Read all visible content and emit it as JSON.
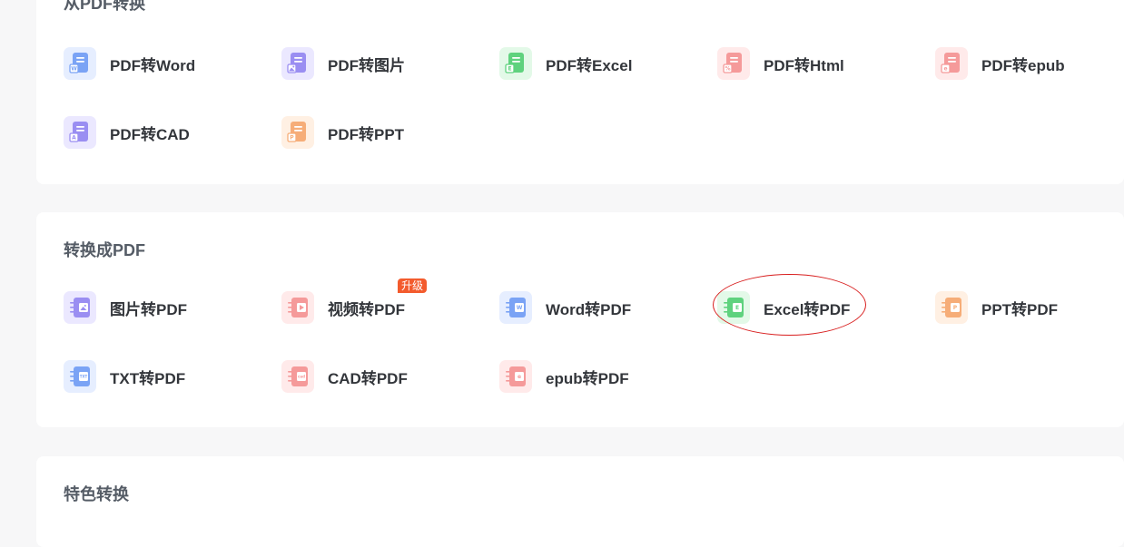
{
  "sections": [
    {
      "title": "从PDF转换",
      "tools": [
        {
          "label": "PDF转Word",
          "icon": "pdf-to-word-icon",
          "bg": "#e6eeff",
          "fg": "#7aa3f5",
          "mark": "W"
        },
        {
          "label": "PDF转图片",
          "icon": "pdf-to-image-icon",
          "bg": "#ebe8ff",
          "fg": "#9a8ef2",
          "mark": "img"
        },
        {
          "label": "PDF转Excel",
          "icon": "pdf-to-excel-icon",
          "bg": "#e3f9e8",
          "fg": "#5fd27e",
          "mark": "E"
        },
        {
          "label": "PDF转Html",
          "icon": "pdf-to-html-icon",
          "bg": "#ffeaea",
          "fg": "#f59a9a",
          "mark": "%"
        },
        {
          "label": "PDF转epub",
          "icon": "pdf-to-epub-icon",
          "bg": "#ffeaea",
          "fg": "#f59a9a",
          "mark": "e"
        },
        {
          "label": "PDF转CAD",
          "icon": "pdf-to-cad-icon",
          "bg": "#ebe8ff",
          "fg": "#9a8ef2",
          "mark": "A"
        },
        {
          "label": "PDF转PPT",
          "icon": "pdf-to-ppt-icon",
          "bg": "#fff0e3",
          "fg": "#f6ad78",
          "mark": "P"
        }
      ]
    },
    {
      "title": "转换成PDF",
      "tools": [
        {
          "label": "图片转PDF",
          "icon": "image-to-pdf-icon",
          "bg": "#ebe8ff",
          "fg": "#9a8ef2",
          "mark": "img"
        },
        {
          "label": "视频转PDF",
          "icon": "video-to-pdf-icon",
          "bg": "#ffeaea",
          "fg": "#f59a9a",
          "mark": "play",
          "badge": "升级"
        },
        {
          "label": "Word转PDF",
          "icon": "word-to-pdf-icon",
          "bg": "#e6eeff",
          "fg": "#7aa3f5",
          "mark": "W"
        },
        {
          "label": "Excel转PDF",
          "icon": "excel-to-pdf-icon",
          "bg": "#e3f9e8",
          "fg": "#5fd27e",
          "mark": "E"
        },
        {
          "label": "PPT转PDF",
          "icon": "ppt-to-pdf-icon",
          "bg": "#fff0e3",
          "fg": "#f6ad78",
          "mark": "P"
        },
        {
          "label": "TXT转PDF",
          "icon": "txt-to-pdf-icon",
          "bg": "#e6eeff",
          "fg": "#7aa3f5",
          "mark": "TXT"
        },
        {
          "label": "CAD转PDF",
          "icon": "cad-to-pdf-icon",
          "bg": "#ffeaea",
          "fg": "#f59a9a",
          "mark": "cad"
        },
        {
          "label": "epub转PDF",
          "icon": "epub-to-pdf-icon",
          "bg": "#ffeaea",
          "fg": "#f59a9a",
          "mark": "e"
        }
      ]
    },
    {
      "title": "特色转换",
      "tools": []
    }
  ],
  "annotation": {
    "highlighted_tool": "Excel转PDF",
    "color": "#d81e1e"
  }
}
